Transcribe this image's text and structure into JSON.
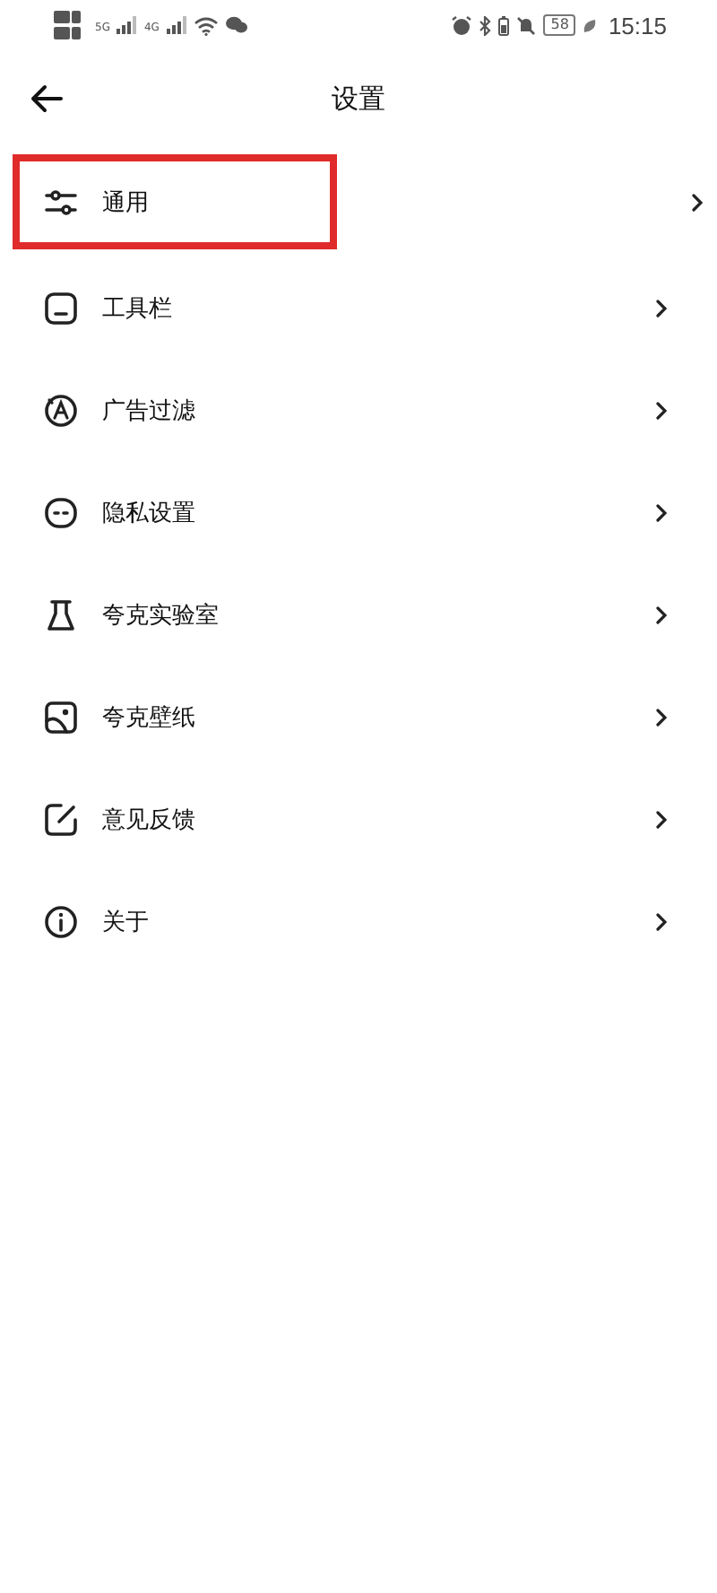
{
  "status_bar": {
    "network_1": "5G",
    "network_2": "4G",
    "battery": "58",
    "time": "15:15"
  },
  "header": {
    "title": "设置"
  },
  "items": [
    {
      "label": "通用",
      "highlighted": true
    },
    {
      "label": "工具栏",
      "highlighted": false
    },
    {
      "label": "广告过滤",
      "highlighted": false
    },
    {
      "label": "隐私设置",
      "highlighted": false
    },
    {
      "label": "夸克实验室",
      "highlighted": false
    },
    {
      "label": "夸克壁纸",
      "highlighted": false
    },
    {
      "label": "意见反馈",
      "highlighted": false
    },
    {
      "label": "关于",
      "highlighted": false
    }
  ]
}
